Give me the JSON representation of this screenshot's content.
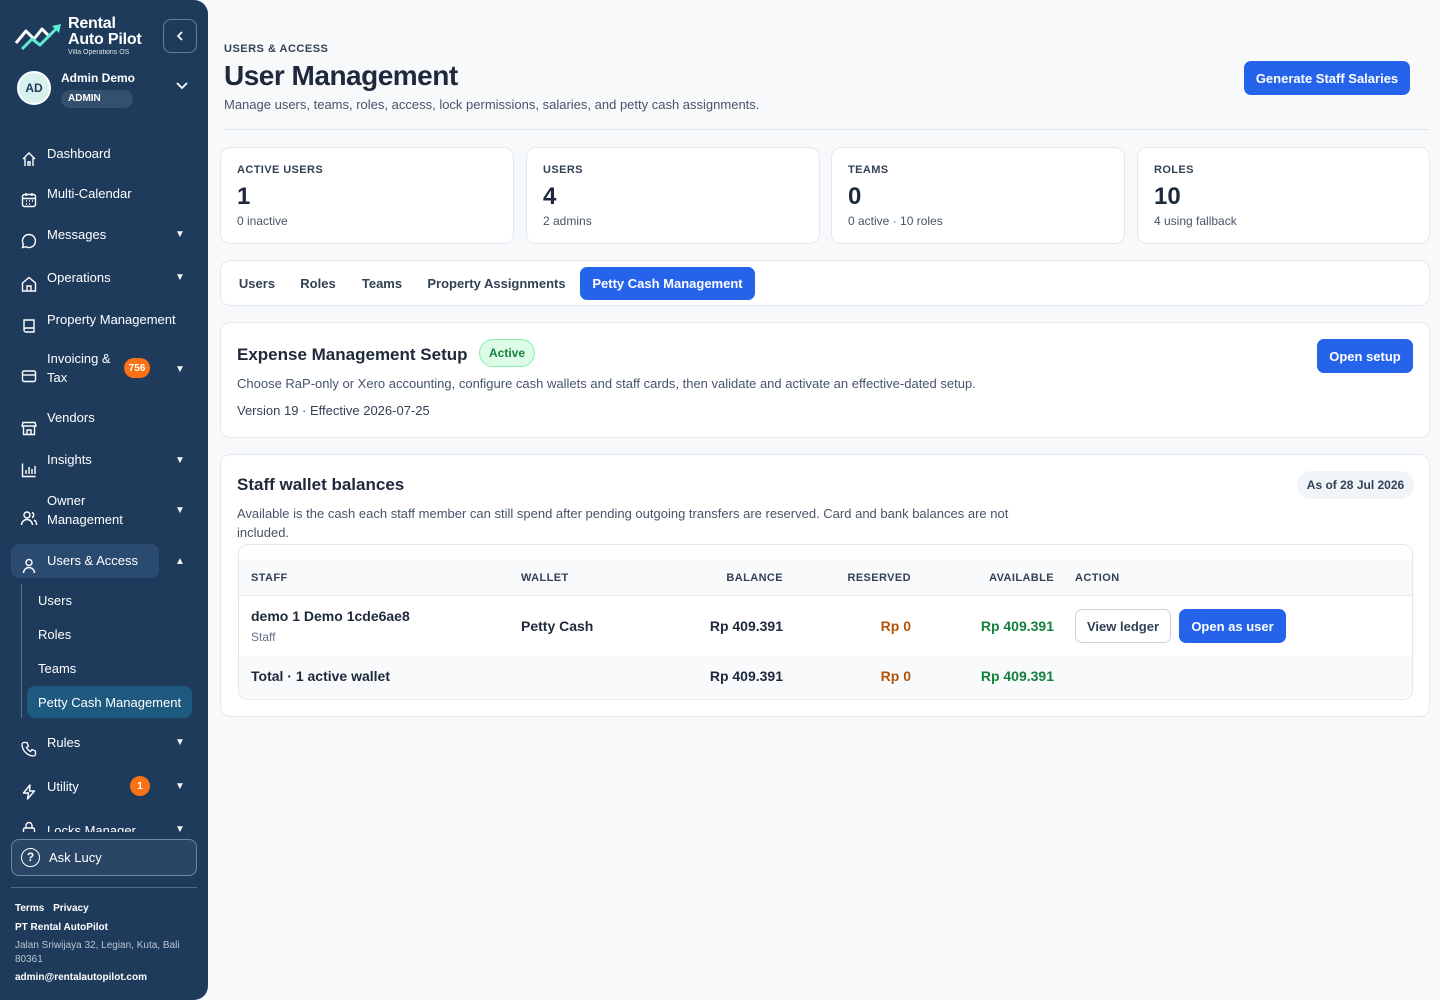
{
  "brand": {
    "line1": "Rental",
    "line2": "Auto Pilot",
    "tagline": "Villa Operations OS"
  },
  "user": {
    "initials": "AD",
    "name": "Admin Demo",
    "role": "ADMIN"
  },
  "nav": {
    "items": [
      {
        "label": "Dashboard",
        "icon": "home-icon"
      },
      {
        "label": "Multi-Calendar",
        "icon": "calendar-icon"
      },
      {
        "label": "Messages",
        "icon": "chat-icon"
      },
      {
        "label": "Operations",
        "icon": "building-icon"
      },
      {
        "label": "Property Management",
        "icon": "book-icon"
      },
      {
        "label": "Invoicing & Tax",
        "icon": "credit-card-icon",
        "badge": "756"
      },
      {
        "label": "Vendors",
        "icon": "store-icon"
      },
      {
        "label": "Insights",
        "icon": "bar-chart-icon"
      },
      {
        "label": "Owner Management",
        "icon": "users-icon"
      },
      {
        "label": "Users & Access",
        "icon": "user-icon"
      },
      {
        "label": "Rules",
        "icon": "phone-icon"
      },
      {
        "label": "Utility",
        "icon": "bolt-icon",
        "badge": "1"
      },
      {
        "label": "Locks Manager",
        "icon": "lock-icon"
      }
    ],
    "sub_items": [
      "Users",
      "Roles",
      "Teams",
      "Petty Cash Management"
    ]
  },
  "ask_lucy": "Ask Lucy",
  "footer": {
    "terms": "Terms",
    "privacy": "Privacy",
    "company": "PT Rental AutoPilot",
    "address": "Jalan Sriwijaya 32, Legian, Kuta, Bali 80361",
    "email": "admin@rentalautopilot.com"
  },
  "header": {
    "eyebrow": "USERS & ACCESS",
    "title": "User Management",
    "subtitle": "Manage users, teams, roles, access, lock permissions, salaries, and petty cash assignments.",
    "action": "Generate Staff Salaries"
  },
  "stats": [
    {
      "label": "ACTIVE USERS",
      "value": "1",
      "note": "0 inactive"
    },
    {
      "label": "USERS",
      "value": "4",
      "note": "2 admins"
    },
    {
      "label": "TEAMS",
      "value": "0",
      "note": "0 active · 10 roles"
    },
    {
      "label": "ROLES",
      "value": "10",
      "note": "4 using fallback"
    }
  ],
  "tabs": [
    "Users",
    "Roles",
    "Teams",
    "Property Assignments",
    "Petty Cash Management"
  ],
  "expense_setup": {
    "title": "Expense Management Setup",
    "status": "Active",
    "description": "Choose RaP-only or Xero accounting, configure cash wallets and staff cards, then validate and activate an effective-dated setup.",
    "version": "Version 19 · Effective 2026-07-25",
    "button": "Open setup"
  },
  "wallets": {
    "title": "Staff wallet balances",
    "as_of": "As of 28 Jul 2026",
    "description": "Available is the cash each staff member can still spend after pending outgoing transfers are reserved. Card and bank balances are not included.",
    "columns": [
      "STAFF",
      "WALLET",
      "BALANCE",
      "RESERVED",
      "AVAILABLE",
      "ACTION"
    ],
    "rows": [
      {
        "staff": "demo 1 Demo 1cde6ae8",
        "staff_role": "Staff",
        "wallet": "Petty Cash",
        "balance": "Rp 409.391",
        "reserved": "Rp 0",
        "available": "Rp 409.391",
        "action_secondary": "View ledger",
        "action_primary": "Open as user"
      }
    ],
    "total": {
      "label": "Total · 1 active wallet",
      "balance": "Rp 409.391",
      "reserved": "Rp 0",
      "available": "Rp 409.391"
    }
  }
}
